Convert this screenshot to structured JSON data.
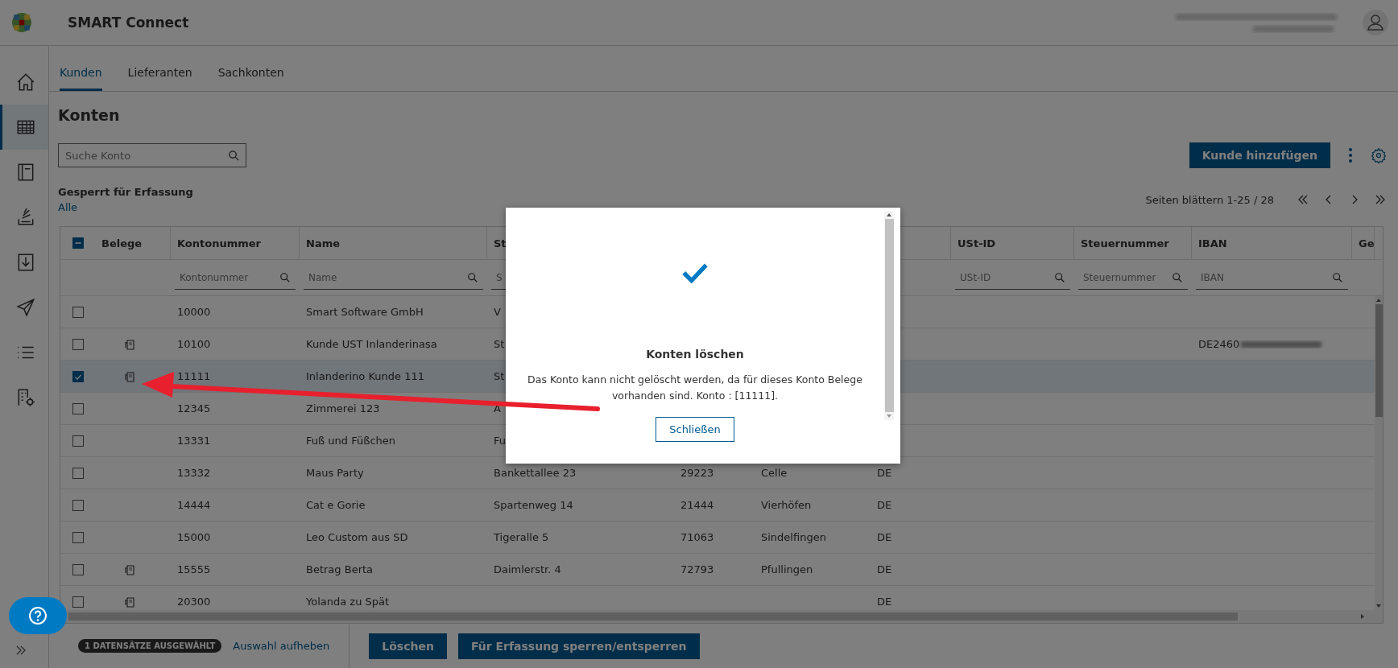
{
  "app": {
    "title": "SMART Connect"
  },
  "sidebar": {
    "items": [
      {
        "kind": "home",
        "selected": false
      },
      {
        "kind": "table",
        "selected": true
      },
      {
        "kind": "book",
        "selected": false
      },
      {
        "kind": "stack",
        "selected": false
      },
      {
        "kind": "import",
        "selected": false
      },
      {
        "kind": "send",
        "selected": false
      },
      {
        "kind": "list",
        "selected": false
      },
      {
        "kind": "building",
        "selected": false
      }
    ]
  },
  "tabs": [
    {
      "label": "Kunden",
      "selected": true
    },
    {
      "label": "Lieferanten",
      "selected": false
    },
    {
      "label": "Sachkonten",
      "selected": false
    }
  ],
  "page_title": "Konten",
  "search": {
    "placeholder": "Suche Konto"
  },
  "add_button": "Kunde hinzufügen",
  "filter": {
    "label": "Gesperrt für Erfassung",
    "value": "Alle"
  },
  "pagination": {
    "text": "Seiten blättern 1-25 / 28"
  },
  "table": {
    "select_all": {
      "indeterminate": true
    },
    "columns": [
      {
        "label": "Belege"
      },
      {
        "label": "Kontonummer",
        "placeholder": "Kontonummer"
      },
      {
        "label": "Name",
        "placeholder": "Name"
      },
      {
        "label": "St",
        "placeholder": "S"
      },
      {
        "label": "USt-ID",
        "placeholder": "USt-ID"
      },
      {
        "label": "Steuernummer",
        "placeholder": "Steuernummer"
      },
      {
        "label": "IBAN",
        "placeholder": "IBAN"
      },
      {
        "label": "Ge"
      }
    ],
    "rows": [
      {
        "selected": false,
        "belege": false,
        "kontonummer": "10000",
        "name": "Smart Software GmbH",
        "street": "V"
      },
      {
        "selected": false,
        "belege": true,
        "kontonummer": "10100",
        "name": "Kunde UST Inlanderinasa",
        "street": "St",
        "iban": "DE2460"
      },
      {
        "selected": true,
        "belege": true,
        "kontonummer": "11111",
        "name": "Inlanderino Kunde 111",
        "street": "St"
      },
      {
        "selected": false,
        "belege": false,
        "kontonummer": "12345",
        "name": "Zimmerei 123",
        "street": "A"
      },
      {
        "selected": false,
        "belege": false,
        "kontonummer": "13331",
        "name": "Fuß und Füßchen",
        "street": "Fu"
      },
      {
        "selected": false,
        "belege": false,
        "kontonummer": "13332",
        "name": "Maus Party",
        "street": "Bankettallee 23",
        "plz": "29223",
        "ort": "Celle",
        "land": "DE"
      },
      {
        "selected": false,
        "belege": false,
        "kontonummer": "14444",
        "name": "Cat e Gorie",
        "street": "Spartenweg 14",
        "plz": "21444",
        "ort": "Vierhöfen",
        "land": "DE"
      },
      {
        "selected": false,
        "belege": false,
        "kontonummer": "15000",
        "name": "Leo Custom aus SD",
        "street": "Tigeralle 5",
        "plz": "71063",
        "ort": "Sindelfingen",
        "land": "DE"
      },
      {
        "selected": false,
        "belege": true,
        "kontonummer": "15555",
        "name": "Betrag Berta",
        "street": "Daimlerstr. 4",
        "plz": "72793",
        "ort": "Pfullingen",
        "land": "DE"
      },
      {
        "selected": false,
        "belege": true,
        "kontonummer": "20300",
        "name": "Yolanda zu Spät",
        "land": "DE"
      }
    ]
  },
  "footer": {
    "badge": "1 DATENSÄTZE AUSGEWÄHLT",
    "link": "Auswahl aufheben",
    "buttons": [
      "Löschen",
      "Für Erfassung sperren/entsperren"
    ]
  },
  "dialog": {
    "title": "Konten löschen",
    "message": "Das Konto kann nicht gelöscht werden, da für dieses Konto Belege vorhanden sind. Konto : [11111].",
    "button": "Schließen"
  }
}
